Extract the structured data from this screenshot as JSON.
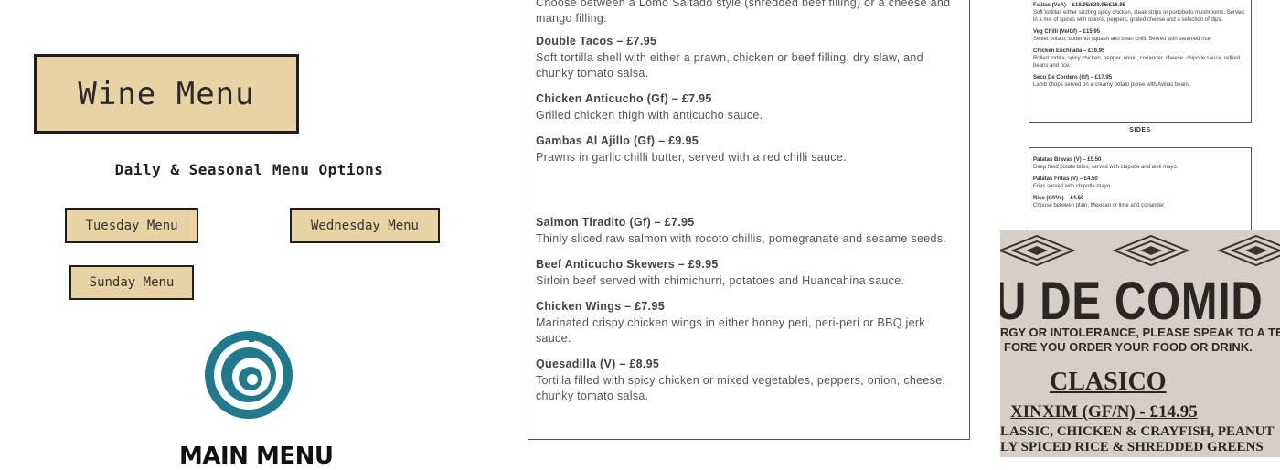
{
  "left": {
    "wine_menu": "Wine Menu",
    "subtitle": "Daily & Seasonal Menu Options",
    "buttons": [
      "Tuesday Menu",
      "Wednesday Menu",
      "Sunday Menu"
    ],
    "main_menu": "MAIN MENU",
    "logo_icon": "spiral-logo-icon",
    "accent_color": "#1f7b8c",
    "button_color": "#e8d3a4"
  },
  "menu": {
    "top_fragment_line1": "Choose between a Lomo Saltado style (shredded beef filling) or a cheese and",
    "top_fragment_line2": "mango filling.",
    "items": [
      {
        "name": "Double Tacos – £7.95",
        "desc": "Soft tortilla shell with either a prawn, chicken or beef filling, dry slaw, and chunky tomato salsa."
      },
      {
        "name": "Chicken Anticucho (Gf) – £7.95",
        "desc": "Grilled chicken thigh with anticucho sauce."
      },
      {
        "name": "Gambas Al Ajillo (Gf) – £9.95",
        "desc": "Prawns in garlic chilli butter, served with a red chilli sauce."
      },
      {
        "name": "Salmon Tiradito (Gf) – £7.95",
        "desc": "Thinly sliced raw salmon with rocoto chillis, pomegranate and sesame seeds."
      },
      {
        "name": "Beef Anticucho Skewers – £9.95",
        "desc": "Sirloin beef served with chimichurri, potatoes and Huancahina sauce."
      },
      {
        "name": "Chicken Wings – £7.95",
        "desc": "Marinated crispy chicken wings in either honey peri, peri-peri or BBQ jerk sauce."
      },
      {
        "name": "Quesadilla (V) – £8.95",
        "desc": "Tortilla filled with spicy chicken or mixed vegetables, peppers, onion, cheese, chunky tomato salsa."
      }
    ]
  },
  "right_menu": {
    "mains": [
      {
        "name": "Fajitas (VeA) – £18.95/£20.95/£16.95",
        "desc": "Soft tortillas either sizzling spicy chicken, steak strips or portobello mushrooms. Served in a mix of spices with onions, peppers, grated cheese and a selection of dips."
      },
      {
        "name": "Veg Chilli (Ve/Gf) – £15.95",
        "desc": "Sweet potato, butternut squash and bean chilli. Served with steamed rice."
      },
      {
        "name": "Chicken Enchilada – £16.95",
        "desc": "Rolled tortilla, spicy chicken, pepper, onion, coriander, cheese, chipotle sauce, refried beans and rice."
      },
      {
        "name": "Seco De Cordero (Gf) – £17.95",
        "desc": "Lamb chops served on a creamy potato puree with Avilias beans."
      }
    ],
    "sides_label": "SIDES",
    "sides": [
      {
        "name": "Patatas Bravas (V) – £5.50",
        "desc": "Deep fried potato bites, served with chipotle and aioli mayo."
      },
      {
        "name": "Patatas Fritas (V) – £4.50",
        "desc": "Fries served with chipotle mayo."
      },
      {
        "name": "Rice (Gf/Ve) – £4.50",
        "desc": "Choose between plain, Mexican or lime and coriander."
      }
    ]
  },
  "photo": {
    "heading": "U DE COMID",
    "warn1": "RGY OR INTOLERANCE, PLEASE SPEAK TO A TEAM",
    "warn2": "FORE YOU ORDER YOUR FOOD OR DRINK.",
    "section": "CLASICO",
    "dish": "XINXIM (GF/N) - £14.95",
    "line1": "LASSIC, CHICKEN & CRAYFISH, PEANUT",
    "line2": "LY SPICED RICE & SHREDDED GREENS"
  }
}
